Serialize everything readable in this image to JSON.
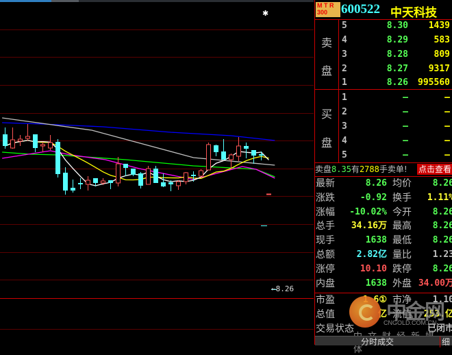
{
  "stock": {
    "badge_line1": "M T R",
    "badge_line2": "300",
    "code": "600522",
    "name": "中天科技"
  },
  "orderbook": {
    "sell_label_1": "卖",
    "sell_label_2": "盘",
    "buy_label_1": "买",
    "buy_label_2": "盘",
    "sell": [
      {
        "level": "5",
        "price": "8.30",
        "volume": "1439"
      },
      {
        "level": "4",
        "price": "8.29",
        "volume": "583"
      },
      {
        "level": "3",
        "price": "8.28",
        "volume": "809"
      },
      {
        "level": "2",
        "price": "8.27",
        "volume": "9317"
      },
      {
        "level": "1",
        "price": "8.26",
        "volume": "995560"
      }
    ],
    "buy": [
      {
        "level": "1",
        "price": "—",
        "volume": "—"
      },
      {
        "level": "2",
        "price": "—",
        "volume": "—"
      },
      {
        "level": "3",
        "price": "—",
        "volume": "—"
      },
      {
        "level": "4",
        "price": "—",
        "volume": "—"
      },
      {
        "level": "5",
        "price": "—",
        "volume": "—"
      }
    ]
  },
  "info_bar": {
    "prefix": "卖盘",
    "price": "8.35",
    "mid": "有",
    "volume": "2788",
    "suffix": "手卖单!",
    "button": "点击查看"
  },
  "stats": [
    {
      "l1": "最新",
      "v1": "8.26",
      "c1": "#55ff55",
      "l2": "均价",
      "v2": "8.26",
      "c2": "#55ff55"
    },
    {
      "l1": "涨跌",
      "v1": "-0.92",
      "c1": "#55ff55",
      "l2": "换手",
      "v2": "1.11%",
      "c2": "#ffff33"
    },
    {
      "l1": "涨幅",
      "v1": "-10.02%",
      "c1": "#55ff55",
      "l2": "今开",
      "v2": "8.26",
      "c2": "#55ff55"
    },
    {
      "l1": "总手",
      "v1": "34.16万",
      "c1": "#ffff33",
      "l2": "最高",
      "v2": "8.26",
      "c2": "#55ff55"
    },
    {
      "l1": "现手",
      "v1": "1638",
      "c1": "#55ff55",
      "l2": "最低",
      "v2": "8.26",
      "c2": "#55ff55"
    },
    {
      "l1": "总额",
      "v1": "2.82亿",
      "c1": "#55ffff",
      "l2": "量比",
      "v2": "1.23",
      "c2": "#c0c0c0"
    },
    {
      "l1": "涨停",
      "v1": "10.10",
      "c1": "#ff5555",
      "l2": "跌停",
      "v2": "8.26",
      "c2": "#55ff55"
    },
    {
      "l1": "内盘",
      "v1": "1638",
      "c1": "#55ff55",
      "l2": "外盘",
      "v2": "34.00万",
      "c2": "#ff5555"
    }
  ],
  "stats2": [
    {
      "l1": "市盈",
      "v1": "1  6①",
      "c1": "#ffff33",
      "l2": "市净",
      "v2": "1.10",
      "c2": "#c0c0c0"
    },
    {
      "l1": "总值",
      "v1": "亿",
      "c1": "#ffff33",
      "l2": "流值",
      "v2": "253.亿",
      "c2": "#ffff33"
    },
    {
      "l1": "交易状态",
      "v1": "",
      "c1": "#c0c0c0",
      "l2": "",
      "v2": "已闭市",
      "c2": "#c0c0c0"
    }
  ],
  "tabs": {
    "tab1": "分时成交",
    "tab2": "细"
  },
  "watermark": {
    "brand": "中金网",
    "domain": "CNGOLD.COM.CN",
    "slogan": "中文财经新媒体"
  },
  "chart_marker": {
    "last_price_label": "←8.26"
  },
  "chart_data": {
    "type": "candlestick",
    "colors": {
      "up": "#ff5555",
      "down": "#55ffff",
      "ma5": "#ffffff",
      "ma10": "#ffff00",
      "green": "#00ff00",
      "magenta": "#ff00ff",
      "gray": "#c0c0c0",
      "blue": "#0000ff"
    },
    "candles": [
      [
        10.0,
        10.2,
        9.58,
        9.66
      ],
      [
        9.6,
        10.2,
        9.58,
        9.84
      ],
      [
        9.8,
        9.98,
        9.66,
        9.86
      ],
      [
        9.88,
        10.3,
        9.82,
        9.94
      ],
      [
        10.0,
        10.0,
        9.48,
        9.6
      ],
      [
        9.66,
        9.78,
        9.48,
        9.7
      ],
      [
        9.6,
        9.98,
        9.54,
        9.76
      ],
      [
        9.78,
        9.86,
        8.74,
        8.84
      ],
      [
        8.88,
        9.04,
        8.24,
        8.36
      ],
      [
        8.44,
        8.68,
        8.3,
        8.36
      ],
      [
        8.58,
        8.72,
        8.4,
        8.54
      ],
      [
        8.54,
        8.78,
        8.36,
        8.66
      ],
      [
        8.72,
        8.72,
        8.48,
        8.58
      ],
      [
        8.58,
        8.72,
        8.52,
        8.64
      ],
      [
        8.66,
        8.66,
        8.4,
        8.58
      ],
      [
        8.58,
        9.34,
        8.48,
        9.14
      ],
      [
        9.14,
        9.14,
        8.78,
        9.02
      ],
      [
        9.0,
        9.0,
        8.78,
        8.82
      ],
      [
        8.86,
        8.9,
        8.42,
        8.5
      ],
      [
        8.54,
        9.08,
        8.54,
        9.0
      ],
      [
        9.0,
        9.08,
        8.58,
        8.58
      ],
      [
        8.6,
        8.86,
        8.46,
        8.48
      ],
      [
        8.6,
        8.66,
        8.34,
        8.54
      ],
      [
        8.5,
        8.66,
        8.38,
        8.62
      ],
      [
        8.62,
        8.9,
        8.54,
        8.88
      ],
      [
        8.82,
        8.92,
        8.62,
        8.78
      ],
      [
        8.78,
        8.98,
        8.72,
        8.94
      ],
      [
        8.96,
        9.76,
        8.96,
        9.7
      ],
      [
        9.68,
        9.7,
        9.36,
        9.48
      ],
      [
        9.5,
        9.86,
        9.26,
        9.26
      ],
      [
        9.26,
        9.44,
        8.98,
        9.4
      ],
      [
        9.36,
        9.92,
        9.22,
        9.66
      ],
      [
        9.66,
        9.76,
        9.3,
        9.58
      ],
      [
        9.54,
        9.54,
        9.14,
        9.38
      ],
      [
        9.42,
        9.5,
        9.24,
        9.38
      ],
      [
        8.26,
        8.26,
        8.26,
        8.26
      ]
    ],
    "lines": {
      "gray": [
        [
          -0.4,
          10.48
        ],
        [
          11.5,
          10.12
        ],
        [
          25,
          9.32
        ],
        [
          35.8,
          9.1
        ]
      ],
      "blue": [
        [
          -0.4,
          10.34
        ],
        [
          5,
          10.3
        ],
        [
          13,
          10.22
        ],
        [
          22,
          10.06
        ],
        [
          30,
          9.96
        ],
        [
          35.8,
          9.82
        ]
      ],
      "green": [
        [
          -0.4,
          9.48
        ],
        [
          3.3,
          9.42
        ],
        [
          6.9,
          9.4
        ],
        [
          16,
          9.26
        ],
        [
          25,
          9.08
        ],
        [
          33.3,
          8.98
        ],
        [
          35.8,
          8.76
        ]
      ],
      "magenta": [
        [
          -0.4,
          9.3
        ],
        [
          6,
          9.52
        ],
        [
          8.7,
          9.4
        ],
        [
          13.3,
          9.26
        ],
        [
          17.8,
          9.0
        ],
        [
          25,
          8.68
        ],
        [
          31.5,
          9.06
        ],
        [
          33.3,
          8.98
        ],
        [
          35.8,
          8.72
        ]
      ]
    },
    "grid": true
  }
}
